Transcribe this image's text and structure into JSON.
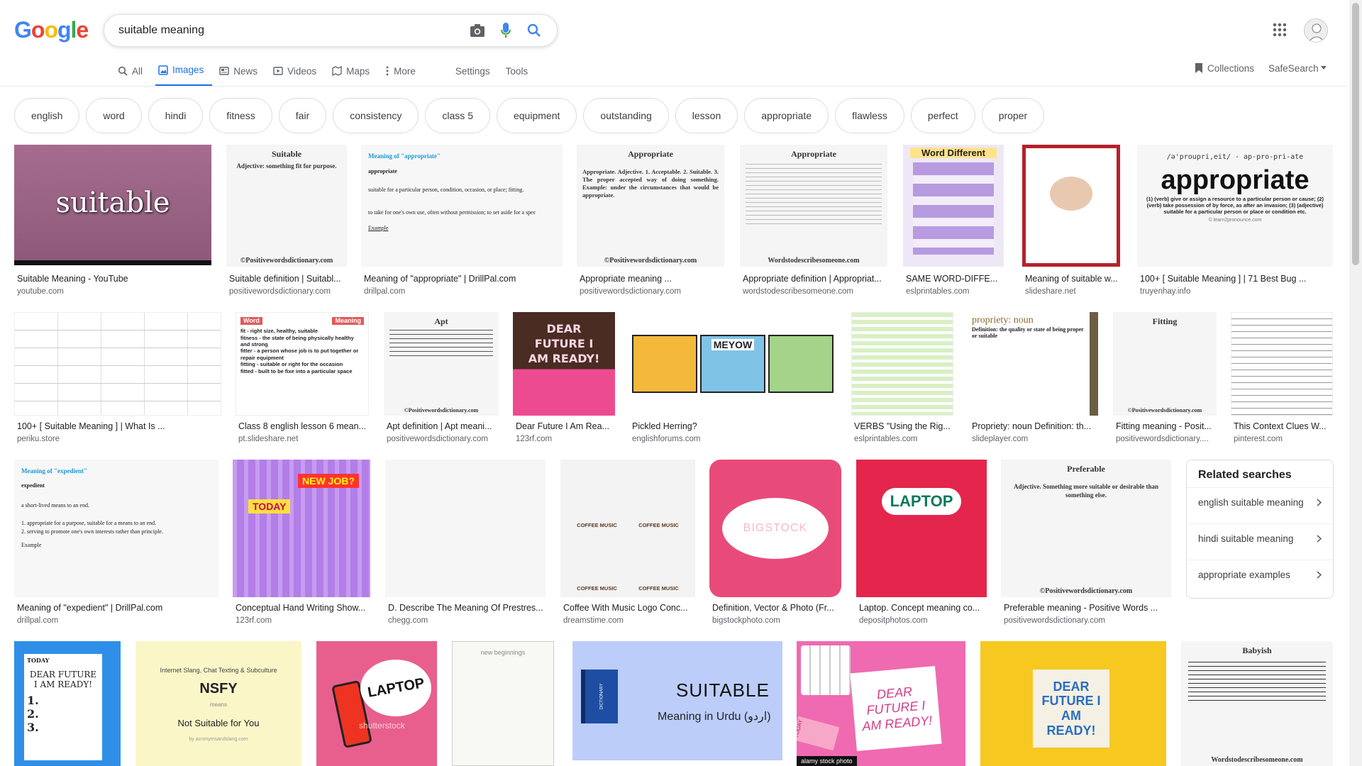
{
  "logo": {
    "letters": [
      "G",
      "o",
      "o",
      "g",
      "l",
      "e"
    ],
    "colors": [
      "#4285F4",
      "#EA4335",
      "#FBBC05",
      "#4285F4",
      "#34A853",
      "#EA4335"
    ]
  },
  "search": {
    "query": "suitable meaning"
  },
  "tabs": [
    "All",
    "Images",
    "News",
    "Videos",
    "Maps",
    "More"
  ],
  "tab_settings": "Settings",
  "tab_tools": "Tools",
  "collections": "Collections",
  "safesearch": "SafeSearch",
  "chips": [
    "english",
    "word",
    "hindi",
    "fitness",
    "fair",
    "consistency",
    "class 5",
    "equipment",
    "outstanding",
    "lesson",
    "appropriate",
    "flawless",
    "perfect",
    "proper"
  ],
  "row1": [
    {
      "title": "Suitable Meaning - YouTube",
      "source": "youtube.com",
      "thumb_text": "suitable"
    },
    {
      "title": "Suitable definition | Suitabl...",
      "source": "positivewordsdictionary.com",
      "thumb_head": "Suitable",
      "thumb_line": "Adjective: something  fit for purpose.",
      "thumb_foot": "©Positivewordsdictionary.com"
    },
    {
      "title": "Meaning of \"appropriate\" | DrillPal.com",
      "source": "drillpal.com",
      "thumb_head": "Meaning of \"appropriate\"",
      "thumb_word": "appropriate",
      "thumb_def": "suitable for a particular person, condition, occasion, or place; fitting.",
      "thumb_def2": "to take for one's own use, often without permission; to set aside for a spec",
      "thumb_ex": "Example"
    },
    {
      "title": "Appropriate meaning ...",
      "source": "positivewordsdictionary.com",
      "thumb_head": "Appropriate",
      "thumb_line": "Appropriate. Adjective. 1. Acceptable. 2. Suitable. 3. The proper accepted way of doing something. Example: under the circumstances that would be appropriate.",
      "thumb_foot": "©Positivewordsdictionary.com"
    },
    {
      "title": "Appropriate definition | Appropriat...",
      "source": "wordstodescribesomeone.com",
      "thumb_head": "Appropriate",
      "thumb_foot": "Wordstodescribesomeone.com"
    },
    {
      "title": "SAME WORD-DIFFE...",
      "source": "eslprintables.com",
      "thumb_head": "Word Different"
    },
    {
      "title": "Meaning of suitable w...",
      "source": "slideshare.net"
    },
    {
      "title": "100+ [ Suitable Meaning ] | 71 Best Bug ...",
      "source": "truyenhay.info",
      "thumb_pron": "/ə'proupri,eit/ - ap-pro-pri-ate",
      "thumb_word": "appropriate",
      "thumb_def": "(1) (verb) give or assign a resource to a particular person or cause; (2) (verb) take possession of by force, as after an invasion; (3) (adjective) suitable for a particular person or place or condition etc.",
      "thumb_foot": "© learn2pronounce.com"
    }
  ],
  "row2": [
    {
      "title": "100+ [ Suitable Meaning ] | What Is ...",
      "source": "periku.store"
    },
    {
      "title": "Class 8 english lesson 6 mean...",
      "source": "pt.slideshare.net",
      "thumb_word": "Word",
      "thumb_meaning": "Meaning",
      "thumb_lines": [
        "fit - right size, healthy, suitable",
        "fitness - the state of being physically healthy and strong",
        "fitter - a person whose job is to put together or repair equipment",
        "fitting - suitable or right for the occasion",
        "fitted - built to be fixe into a particular space"
      ]
    },
    {
      "title": "Apt definition | Apt meani...",
      "source": "positivewordsdictionary.com",
      "thumb_head": "Apt",
      "thumb_foot": "©Positivewordsdictionary.com"
    },
    {
      "title": "Dear Future I Am Rea...",
      "source": "123rf.com",
      "thumb_text": "DEAR FUTURE I AM READY!"
    },
    {
      "title": "Pickled Herring?",
      "source": "englishforums.com",
      "thumb_text": "MEYOW"
    },
    {
      "title": "VERBS \"Using the Rig...",
      "source": "eslprintables.com"
    },
    {
      "title": "Propriety: noun Definition: th...",
      "source": "slideplayer.com",
      "thumb_head": "propriety: noun",
      "thumb_line": "Definition: the quality or state of being proper or suitable"
    },
    {
      "title": "Fitting meaning - Posit...",
      "source": "positivewordsdictionary....",
      "thumb_head": "Fitting",
      "thumb_foot": "©Positivewordsdictionary.com"
    },
    {
      "title": "This Context Clues W...",
      "source": "pinterest.com"
    }
  ],
  "row3": [
    {
      "title": "Meaning of \"expedient\" | DrillPal.com",
      "source": "drillpal.com",
      "thumb_head": "Meaning of \"expedient\"",
      "thumb_word": "expedient",
      "thumb_def": "a short-lived means to an end.",
      "thumb_def2": "1. appropriate for a purpose, suitable for a means to an end.",
      "thumb_def3": "2. serving to promote one's own interests rather than principle.",
      "thumb_ex": "Example"
    },
    {
      "title": "Conceptual Hand Writing Show...",
      "source": "123rf.com",
      "thumb_a": "TODAY",
      "thumb_b": "NEW JOB?"
    },
    {
      "title": "D. Describe The Meaning Of Prestres...",
      "source": "chegg.com"
    },
    {
      "title": "Coffee With Music Logo Conc...",
      "source": "dreamstime.com",
      "thumb_text": "COFFEE MUSIC"
    },
    {
      "title": "Definition, Vector & Photo (Fr...",
      "source": "bigstockphoto.com",
      "thumb_text": "BIGSTOCK"
    },
    {
      "title": "Laptop. Concept meaning co...",
      "source": "depositphotos.com",
      "thumb_text": "LAPTOP"
    },
    {
      "title": "Preferable meaning - Positive Words ...",
      "source": "positivewordsdictionary.com",
      "thumb_head": "Preferable",
      "thumb_line": "Adjective. Something more suitable or desirable than something else.",
      "thumb_foot": "©Positivewordsdictionary.com"
    }
  ],
  "related": {
    "title": "Related searches",
    "items": [
      "english suitable meaning",
      "hindi suitable meaning",
      "appropriate examples"
    ]
  },
  "row4": [
    {
      "thumb_a": "TODAY",
      "thumb_b": "DEAR FUTURE I AM READY!",
      "thumb_list": [
        "1.",
        "2.",
        "3."
      ]
    },
    {
      "thumb_a": "Internet Slang, Chat Texting & Subculture",
      "thumb_b": "NSFY",
      "thumb_c": "means",
      "thumb_d": "Not Suitable for You",
      "thumb_e": "by acronymsandslang.com"
    },
    {
      "thumb_a": "LAPTOP",
      "thumb_b": "shutterstock"
    },
    {
      "thumb_a": "new beginnings"
    },
    {
      "thumb_a": "SUITABLE",
      "thumb_b": "Meaning in Urdu (اردو)",
      "thumb_c": "DICTIONARY"
    },
    {
      "thumb_a": "DEAR FUTURE I AM READY!",
      "thumb_b": "alamy stock photo",
      "thumb_c": "TODAY"
    },
    {
      "thumb_a": "DEAR FUTURE I AM READY!"
    },
    {
      "thumb_a": "Babyish",
      "thumb_b": "Wordstodescribesomeone.com"
    }
  ]
}
